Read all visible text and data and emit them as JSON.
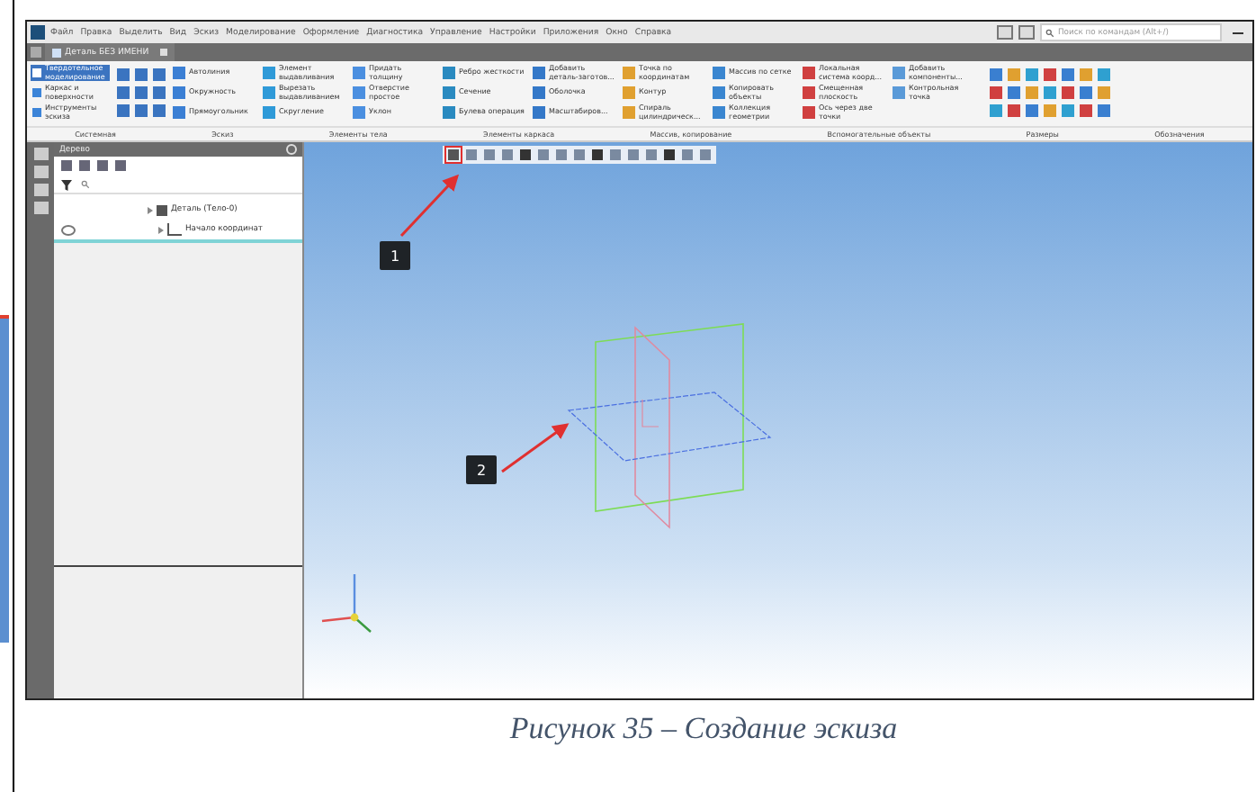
{
  "menu": [
    "Файл",
    "Правка",
    "Выделить",
    "Вид",
    "Эскиз",
    "Моделирование",
    "Оформление",
    "Диагностика",
    "Управление",
    "Настройки",
    "Приложения",
    "Окно",
    "Справка"
  ],
  "search": {
    "placeholder": "Поиск по командам (Alt+/)"
  },
  "doc_tab": {
    "title": "Деталь БЕЗ ИМЕНИ"
  },
  "ribbon": {
    "modes": [
      {
        "label": "Твердотельное моделирование",
        "selected": true
      },
      {
        "label": "Каркас и поверхности",
        "selected": false
      },
      {
        "label": "Инструменты эскиза",
        "selected": false
      }
    ],
    "columns": [
      [
        "Автолиния",
        "Окружность",
        "Прямоугольник"
      ],
      [
        "Элемент выдавливания",
        "Вырезать выдавливанием",
        "Скругление"
      ],
      [
        "Придать толщину",
        "Отверстие простое",
        "Уклон"
      ],
      [
        "Ребро жесткости",
        "Сечение",
        "Булева операция"
      ],
      [
        "Добавить деталь-заготов...",
        "Оболочка",
        "Масштабиров..."
      ],
      [
        "Точка по координатам",
        "Контур",
        "Спираль цилиндрическ..."
      ],
      [
        "Массив по сетке",
        "Копировать объекты",
        "Коллекция геометрии"
      ],
      [
        "Локальная система коорд...",
        "Смещенная плоскость",
        "Ось через две точки"
      ],
      [
        "Добавить компоненты...",
        "Контрольная точка"
      ]
    ],
    "group_labels": [
      "Системная",
      "Эскиз",
      "Элементы тела",
      "Элементы каркаса",
      "Массив, копирование",
      "Вспомогательные объекты",
      "Размеры",
      "Обозначения"
    ]
  },
  "tree_panel": {
    "title": "Дерево",
    "items": [
      {
        "label": "Деталь (Тело-0)",
        "children": [
          {
            "label": "Начало координат"
          }
        ]
      }
    ]
  },
  "callouts": [
    "1",
    "2"
  ],
  "caption": "Рисунок 35 – Создание эскиза"
}
